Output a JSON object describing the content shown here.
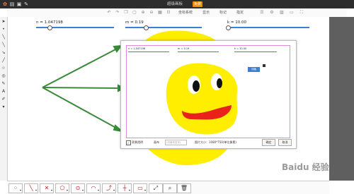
{
  "app": {
    "title": "超级画板",
    "badge": "免费",
    "top_icons": [
      "logo-icon",
      "file-icon",
      "save-icon",
      "settings-icon"
    ]
  },
  "toolbar2": {
    "menus": [
      "坐标系统",
      "显示",
      "标记",
      "指定"
    ]
  },
  "sliders": [
    {
      "label": "n = 1.047198",
      "value": 0.16
    },
    {
      "label": "m = 0.19",
      "value": 0.25
    },
    {
      "label": "k = 10.00",
      "value": 0.0
    }
  ],
  "dialog": {
    "sliders": [
      {
        "label": "n = 1.047198"
      },
      {
        "label": "m = 0.19"
      },
      {
        "label": "k = 10.00"
      }
    ],
    "inner_button": "动画",
    "checkbox_label": "背景透明",
    "checkbox_checked": true,
    "name_label": "画布",
    "name_placeholder": "(可用作名字)",
    "size_label": "图片大小：1080*750(单位像素)",
    "ok_label": "确定",
    "cancel_label": "取消"
  },
  "watermark": "Baidu 经验",
  "colors": {
    "blob_yellow": "#ffee00",
    "mouth_red": "#e8221b",
    "arrow_green": "#3a8a3a",
    "slider_blue": "#3d7fd4",
    "dialog_border": "#e08ad8"
  }
}
